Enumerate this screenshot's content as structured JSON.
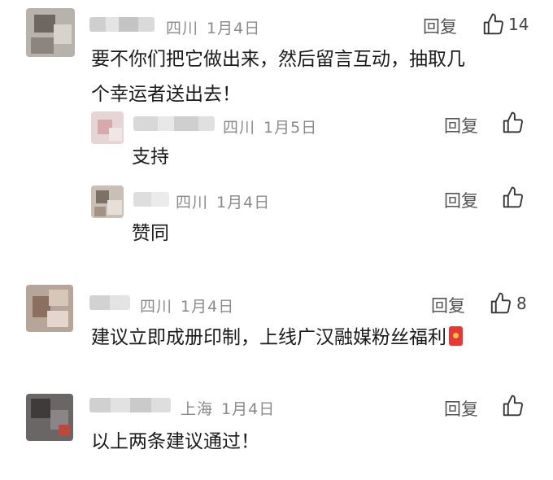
{
  "reply_label": "回复",
  "comments": [
    {
      "location": "四川",
      "date": "1月4日",
      "likes": "14",
      "text_lines": [
        "要不你们把它做出来，然后留言互动，抽取几",
        "个幸运者送出去！"
      ],
      "replies": [
        {
          "location": "四川",
          "date": "1月5日",
          "text": "支持"
        },
        {
          "location": "四川",
          "date": "1月4日",
          "text": "赞同"
        }
      ]
    },
    {
      "location": "四川",
      "date": "1月4日",
      "likes": "8",
      "text_lines": [
        "建议立即成册印制，上线广汉融媒粉丝福利"
      ],
      "emoji": "red-envelope-icon"
    },
    {
      "location": "上海",
      "date": "1月4日",
      "likes": "",
      "text_lines": [
        "以上两条建议通过！"
      ]
    }
  ]
}
